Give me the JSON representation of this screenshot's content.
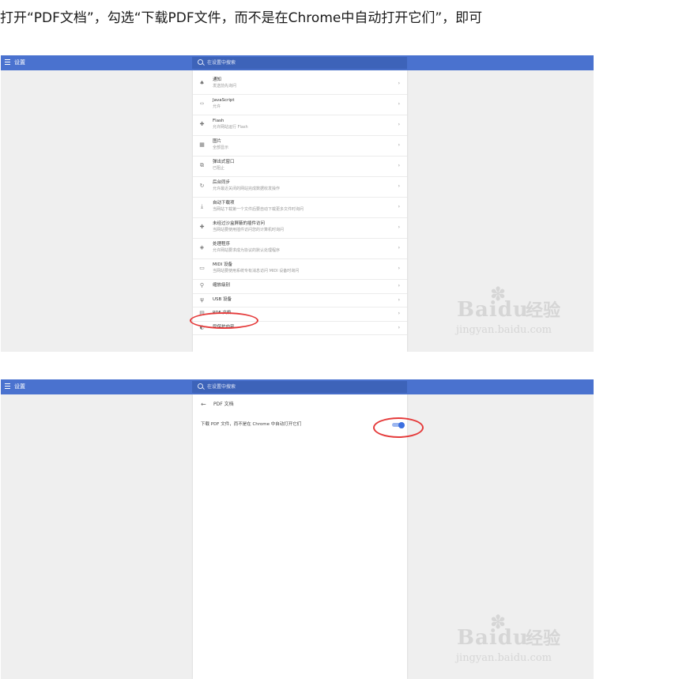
{
  "instruction": "打开“PDF文档”，勾选“下载PDF文件，而不是在Chrome中自动打开它们”，即可",
  "settings_title": "设置",
  "search_placeholder": "在设置中搜索",
  "content_settings": [
    {
      "icon": "bell-icon",
      "glyph": "♠",
      "title": "通知",
      "subtitle": "发送前先询问"
    },
    {
      "icon": "code-icon",
      "glyph": "‹›",
      "title": "JavaScript",
      "subtitle": "允许"
    },
    {
      "icon": "puzzle-icon",
      "glyph": "✚",
      "title": "Flash",
      "subtitle": "允许网站运行 Flash"
    },
    {
      "icon": "image-icon",
      "glyph": "▦",
      "title": "图片",
      "subtitle": "全部显示"
    },
    {
      "icon": "popup-icon",
      "glyph": "⧉",
      "title": "弹出式窗口",
      "subtitle": "已阻止"
    },
    {
      "icon": "sync-icon",
      "glyph": "↻",
      "title": "后台同步",
      "subtitle": "允许最近关闭的网站完成数据收发操作"
    },
    {
      "icon": "download-icon",
      "glyph": "⤓",
      "title": "自动下载项",
      "subtitle": "当网站下载第一个文件后要自动下载更多文件时询问"
    },
    {
      "icon": "plugin-icon",
      "glyph": "✚",
      "title": "未经过沙盒屏蔽的插件访问",
      "subtitle": "当网站要使用插件访问您的计算机时询问"
    },
    {
      "icon": "handler-icon",
      "glyph": "◈",
      "title": "处理程序",
      "subtitle": "允许网站要求成为协议的默认处理程序"
    },
    {
      "icon": "midi-icon",
      "glyph": "▭",
      "title": "MIDI 设备",
      "subtitle": "当网站要使用系统专有消息访问 MIDI 设备时询问"
    },
    {
      "icon": "zoom-icon",
      "glyph": "⚲",
      "title": "缩放级别",
      "subtitle": ""
    },
    {
      "icon": "usb-icon",
      "glyph": "ψ",
      "title": "USB 设备",
      "subtitle": ""
    },
    {
      "icon": "pdf-icon",
      "glyph": "▤",
      "title": "PDF 文档",
      "subtitle": ""
    },
    {
      "icon": "protected-content-icon",
      "glyph": "◐",
      "title": "受保护内容",
      "subtitle": ""
    }
  ],
  "pdf_page": {
    "title": "PDF 文档",
    "toggle_label": "下载 PDF 文件，而不是在 Chrome 中自动打开它们",
    "toggle_on": true
  },
  "watermark": {
    "brand": "Bai",
    "brand_suffix": "du",
    "product": "经验",
    "url": "jingyan.baidu.com"
  },
  "colors": {
    "topbar": "#4a72cf",
    "highlight": "#e53b3b",
    "toggle": "#3b6fe0"
  }
}
